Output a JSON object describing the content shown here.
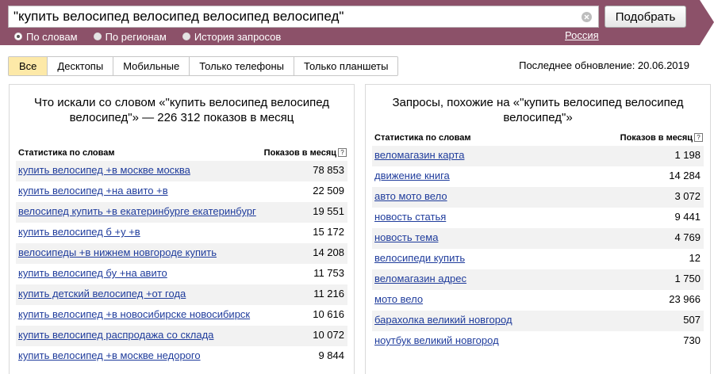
{
  "search": {
    "query": "\"купить велосипед велосипед велосипед велосипед\"",
    "button_label": "Подобрать"
  },
  "modes": [
    {
      "label": "По словам",
      "selected": true
    },
    {
      "label": "По регионам",
      "selected": false
    },
    {
      "label": "История запросов",
      "selected": false
    }
  ],
  "region": "Россия",
  "tabs": [
    {
      "label": "Все",
      "active": true
    },
    {
      "label": "Десктопы",
      "active": false
    },
    {
      "label": "Мобильные",
      "active": false
    },
    {
      "label": "Только телефоны",
      "active": false
    },
    {
      "label": "Только планшеты",
      "active": false
    }
  ],
  "last_update": "Последнее обновление: 20.06.2019",
  "left_panel": {
    "title": "Что искали со словом «\"купить велосипед велосипед велосипед\"» — 226 312 показов в месяц",
    "col_stat": "Статистика по словам",
    "col_count": "Показов в месяц",
    "rows": [
      {
        "phrase": "купить велосипед +в москве москва",
        "count": "78 853"
      },
      {
        "phrase": "купить велосипед +на авито +в",
        "count": "22 509"
      },
      {
        "phrase": "велосипед купить +в екатеринбурге екатеринбург",
        "count": "19 551"
      },
      {
        "phrase": "купить велосипед б +у +в",
        "count": "15 172"
      },
      {
        "phrase": "велосипеды +в нижнем новгороде купить",
        "count": "14 208"
      },
      {
        "phrase": "купить велосипед бу +на авито",
        "count": "11 753"
      },
      {
        "phrase": "купить детский велосипед +от года",
        "count": "11 216"
      },
      {
        "phrase": "купить велосипед +в новосибирске новосибирск",
        "count": "10 616"
      },
      {
        "phrase": "купить велосипед распродажа со склада",
        "count": "10 072"
      },
      {
        "phrase": "купить велосипед +в москве недорого",
        "count": "9 844"
      }
    ]
  },
  "right_panel": {
    "title": "Запросы, похожие на «\"купить велосипед велосипед велосипед\"»",
    "col_stat": "Статистика по словам",
    "col_count": "Показов в месяц",
    "rows": [
      {
        "phrase": "веломагазин карта",
        "count": "1 198"
      },
      {
        "phrase": "движение книга",
        "count": "14 284"
      },
      {
        "phrase": "авто мото вело",
        "count": "3 072"
      },
      {
        "phrase": "новость статья",
        "count": "9 441"
      },
      {
        "phrase": "новость тема",
        "count": "4 769"
      },
      {
        "phrase": "велосипеди купить",
        "count": "12"
      },
      {
        "phrase": "веломагазин адрес",
        "count": "1 750"
      },
      {
        "phrase": "мото вело",
        "count": "23 966"
      },
      {
        "phrase": "барахолка великий новгород",
        "count": "507"
      },
      {
        "phrase": "ноутбук великий новгород",
        "count": "730"
      }
    ]
  },
  "colors": {
    "header_bg": "#8c5169",
    "tab_active_bg": "#fde9a8",
    "link": "#1f3c9c",
    "row_stripe": "#f2f2f2"
  },
  "icons": {
    "clear": "clear-icon",
    "help": "help-icon"
  }
}
